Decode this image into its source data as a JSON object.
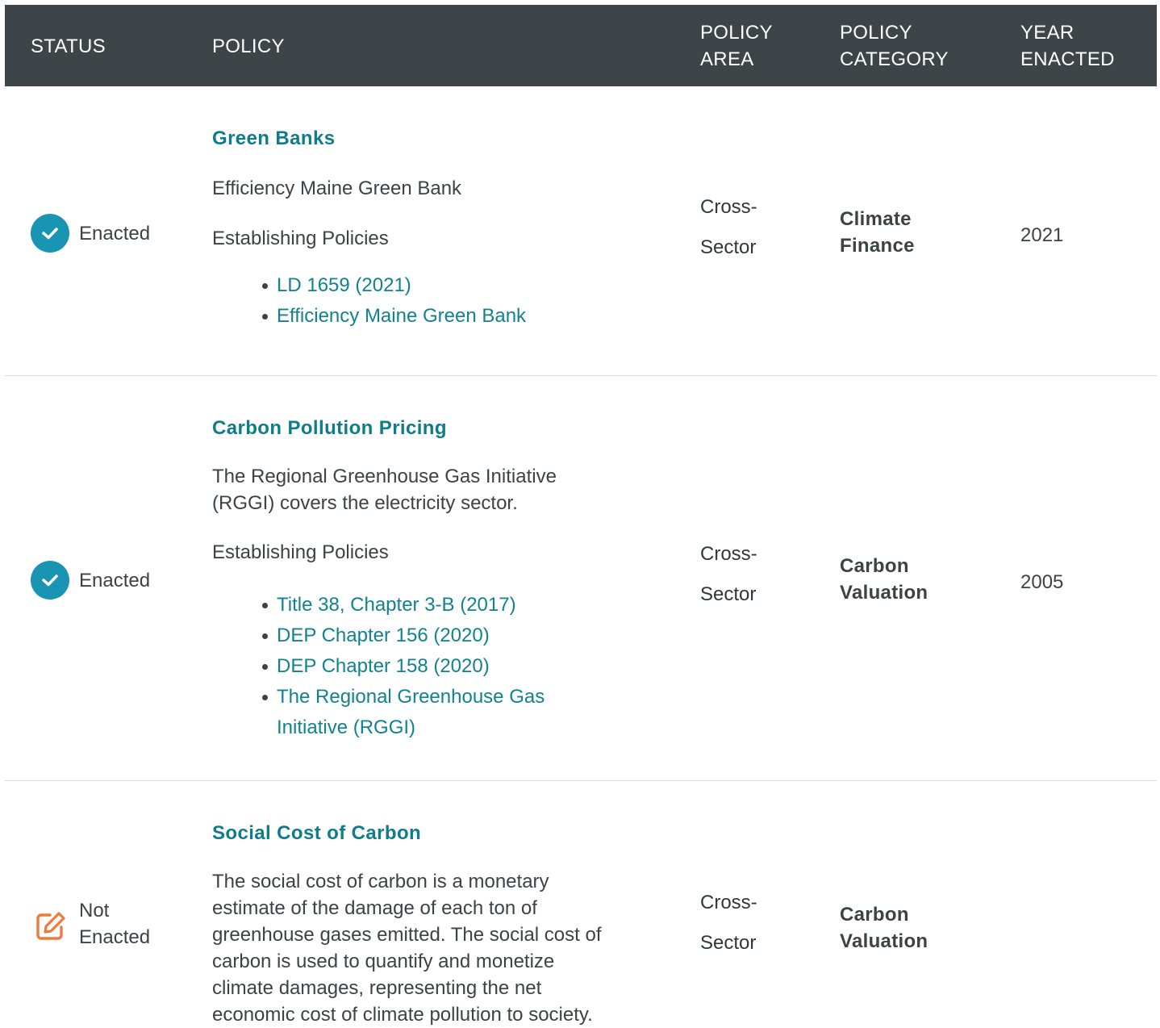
{
  "header": {
    "status": "STATUS",
    "policy": "POLICY",
    "policy_area": [
      "POLICY",
      "AREA"
    ],
    "policy_category": [
      "POLICY",
      "CATEGORY"
    ],
    "year_enacted": [
      "YEAR",
      "ENACTED"
    ]
  },
  "rows": [
    {
      "status": "Enacted",
      "status_icon": "check-circle-icon",
      "title": "Green Banks",
      "description": "Efficiency Maine Green Bank",
      "establishing_label": "Establishing Policies",
      "links": [
        "LD 1659 (2021)",
        "Efficiency Maine Green Bank"
      ],
      "area": [
        "Cross-",
        "Sector"
      ],
      "category": [
        "Climate",
        "Finance"
      ],
      "year": "2021"
    },
    {
      "status": "Enacted",
      "status_icon": "check-circle-icon",
      "title": "Carbon Pollution Pricing",
      "description": [
        "The Regional Greenhouse Gas Initiative",
        "(RGGI) covers the electricity sector."
      ],
      "establishing_label": "Establishing Policies",
      "links": [
        "Title 38, Chapter 3-B (2017)",
        "DEP Chapter 156 (2020)",
        "DEP Chapter 158 (2020)",
        [
          "The Regional Greenhouse Gas",
          "Initiative (RGGI)"
        ]
      ],
      "area": [
        "Cross-",
        "Sector"
      ],
      "category": [
        "Carbon",
        "Valuation"
      ],
      "year": "2005"
    },
    {
      "status": [
        "Not",
        "Enacted"
      ],
      "status_icon": "edit-icon",
      "title": "Social Cost of Carbon",
      "description": [
        "The social cost of carbon is a monetary",
        "estimate of the damage of each ton of",
        "greenhouse gases emitted. The social cost of",
        "carbon is used to quantify and monetize",
        "climate damages, representing the net",
        "economic cost of climate pollution to society."
      ],
      "area": [
        "Cross-",
        "Sector"
      ],
      "category": [
        "Carbon",
        "Valuation"
      ],
      "year": ""
    }
  ],
  "colors": {
    "header_bg": "#3d4549",
    "link": "#11838f",
    "title": "#0f7c8c",
    "enacted_icon": "#1a94b3",
    "not_enacted_icon": "#ee7b3d"
  }
}
